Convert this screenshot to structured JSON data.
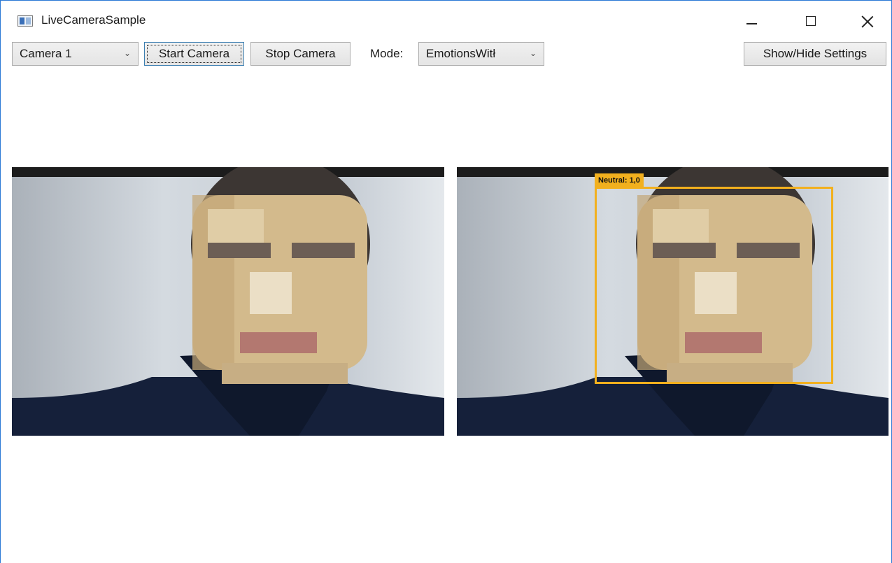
{
  "window": {
    "title": "LiveCameraSample",
    "icon": "app-window-icon"
  },
  "toolbar": {
    "camera_select": {
      "value": "Camera 1",
      "icon": "chevron-down-icon"
    },
    "start_label": "Start Camera",
    "stop_label": "Stop Camera",
    "mode_label": "Mode:",
    "mode_select": {
      "value": "EmotionsWitł",
      "icon": "chevron-down-icon"
    },
    "settings_label": "Show/Hide Settings"
  },
  "camera_views": {
    "left": {
      "name": "raw-camera-feed"
    },
    "right": {
      "name": "analyzed-camera-feed",
      "detection": {
        "label": "Neutral: 1,0",
        "box_color": "#f2b01e"
      }
    }
  },
  "colors": {
    "window_border": "#2b79d6",
    "detection_box": "#f2b01e"
  }
}
